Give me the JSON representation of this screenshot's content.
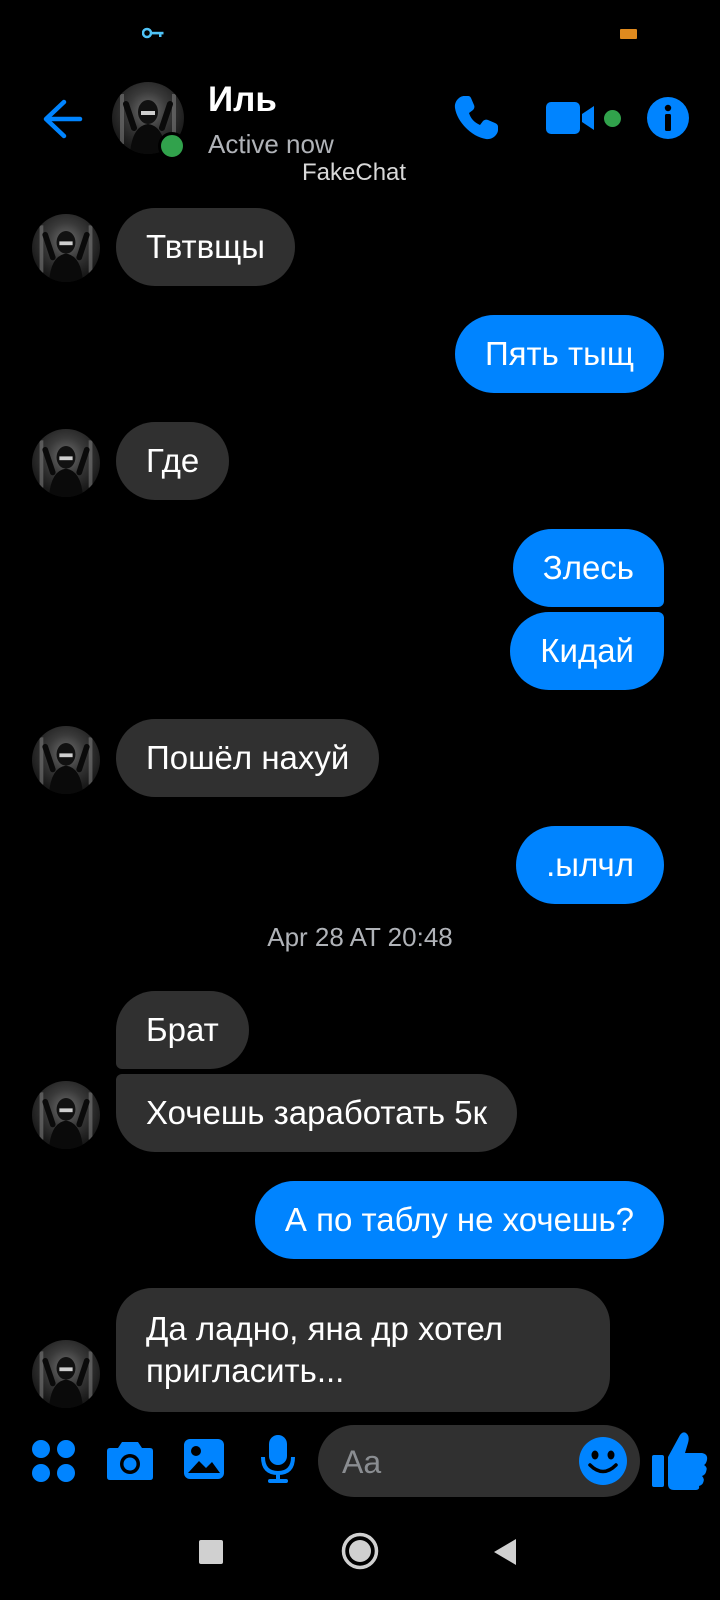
{
  "colors": {
    "accent": "#0084ff",
    "incoming_bubble": "#303030",
    "outgoing_bubble": "#0084ff",
    "online": "#31a24c",
    "background": "#000000"
  },
  "header": {
    "contact_name": "Иль",
    "status": "Active now",
    "watermark": "FakeChat",
    "icons": [
      "back-arrow-icon",
      "phone-icon",
      "video-camera-icon",
      "info-icon"
    ]
  },
  "messages": [
    {
      "direction": "incoming",
      "text": "Твтвщы",
      "avatar": true
    },
    {
      "direction": "outgoing",
      "text": "Пять тыщ"
    },
    {
      "direction": "incoming",
      "text": "Где",
      "avatar": true
    },
    {
      "direction": "outgoing",
      "text": "Злесь"
    },
    {
      "direction": "outgoing",
      "text": "Кидай"
    },
    {
      "direction": "incoming",
      "text": "Пошёл нахуй",
      "avatar": true
    },
    {
      "direction": "outgoing",
      "text": ".ылчл"
    },
    {
      "direction": "incoming",
      "text": "Брат"
    },
    {
      "direction": "incoming",
      "text": "Хочешь заработать 5к",
      "avatar": true
    },
    {
      "direction": "outgoing",
      "text": "А по таблу не хочешь?"
    },
    {
      "direction": "incoming",
      "text": "Да ладно, яна др хотел пригласить...",
      "avatar": true
    }
  ],
  "timestamp": "Apr 28 AT 20:48",
  "composer": {
    "placeholder": "Aa",
    "icons": [
      "menu-dots-icon",
      "camera-icon",
      "gallery-icon",
      "microphone-icon",
      "emoji-icon",
      "thumbs-up-icon"
    ]
  },
  "navbar": {
    "icons": [
      "recents-square-icon",
      "home-circle-icon",
      "back-triangle-icon"
    ]
  }
}
